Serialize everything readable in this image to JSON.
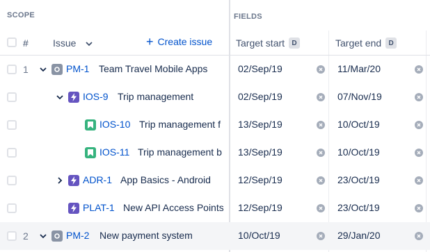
{
  "header": {
    "scope_label": "SCOPE",
    "fields_label": "FIELDS",
    "hash_label": "#",
    "issue_label": "Issue",
    "create_issue_label": "Create issue",
    "target_start_label": "Target start",
    "target_end_label": "Target end",
    "date_badge": "D"
  },
  "colors": {
    "link": "#0052cc",
    "initiative_icon": "#8993a4",
    "epic_icon": "#6554c0",
    "story_icon": "#36b37e"
  },
  "rows": [
    {
      "num": "1",
      "chevron": "down",
      "icon": "initiative-icon",
      "key": "PM-1",
      "title": "Team Travel Mobile Apps",
      "start": "02/Sep/19",
      "end": "11/Mar/20"
    },
    {
      "num": "",
      "chevron": "down",
      "icon": "epic-icon",
      "key": "IOS-9",
      "title": "Trip management",
      "start": "02/Sep/19",
      "end": "07/Nov/19"
    },
    {
      "num": "",
      "chevron": "",
      "icon": "story-icon",
      "key": "IOS-10",
      "title": "Trip management f",
      "start": "13/Sep/19",
      "end": "10/Oct/19"
    },
    {
      "num": "",
      "chevron": "",
      "icon": "story-icon",
      "key": "IOS-11",
      "title": "Trip management b",
      "start": "13/Sep/19",
      "end": "10/Oct/19"
    },
    {
      "num": "",
      "chevron": "right",
      "icon": "epic-icon",
      "key": "ADR-1",
      "title": "App Basics - Android",
      "start": "12/Sep/19",
      "end": "23/Oct/19"
    },
    {
      "num": "",
      "chevron": "",
      "icon": "epic-icon",
      "key": "PLAT-1",
      "title": "New API Access Points",
      "start": "12/Sep/19",
      "end": "23/Oct/19"
    },
    {
      "num": "2",
      "chevron": "down",
      "icon": "initiative-icon",
      "key": "PM-2",
      "title": "New payment system",
      "start": "10/Oct/19",
      "end": "29/Jan/20"
    }
  ]
}
